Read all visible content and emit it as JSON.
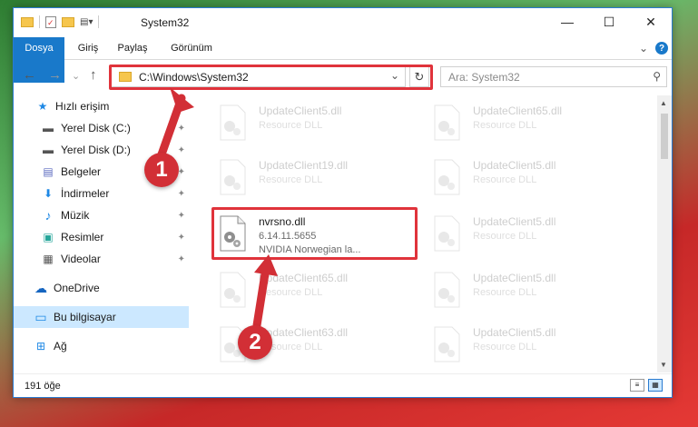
{
  "window": {
    "title": "System32",
    "minimize_glyph": "—",
    "maximize_glyph": "☐",
    "close_glyph": "✕"
  },
  "ribbon": {
    "tabs": [
      "Dosya",
      "Giriş",
      "Paylaş",
      "Görünüm"
    ],
    "expand_glyph": "⌄",
    "help_glyph": "?"
  },
  "nav": {
    "back": "←",
    "forward": "→",
    "recent": "⌄",
    "up": "↑",
    "address": "C:\\Windows\\System32",
    "address_dropdown": "⌄",
    "refresh": "↻",
    "search_placeholder": "Ara: System32",
    "search_glyph": "⚲"
  },
  "sidebar": {
    "items": [
      {
        "label": "Hızlı erişim",
        "icon": "star-icon",
        "glyph": "★",
        "color": "#1e88e5",
        "pinned": false
      },
      {
        "label": "Yerel Disk (C:)",
        "icon": "drive-icon",
        "glyph": "▬",
        "color": "#555555",
        "pinned": true
      },
      {
        "label": "Yerel Disk (D:)",
        "icon": "drive-icon",
        "glyph": "▬",
        "color": "#555555",
        "pinned": true
      },
      {
        "label": "Belgeler",
        "icon": "document-icon",
        "glyph": "▤",
        "color": "#5c6bc0",
        "pinned": true
      },
      {
        "label": "İndirmeler",
        "icon": "download-icon",
        "glyph": "⬇",
        "color": "#1e88e5",
        "pinned": true
      },
      {
        "label": "Müzik",
        "icon": "music-icon",
        "glyph": "♪",
        "color": "#1e88e5",
        "pinned": true
      },
      {
        "label": "Resimler",
        "icon": "pictures-icon",
        "glyph": "▣",
        "color": "#26a69a",
        "pinned": true
      },
      {
        "label": "Videolar",
        "icon": "video-icon",
        "glyph": "▦",
        "color": "#555555",
        "pinned": true
      },
      {
        "label": "OneDrive",
        "icon": "cloud-icon",
        "glyph": "☁",
        "color": "#1565c0",
        "pinned": false
      },
      {
        "label": "Bu bilgisayar",
        "icon": "computer-icon",
        "glyph": "▭",
        "color": "#1e88e5",
        "pinned": false,
        "selected": true
      },
      {
        "label": "Ağ",
        "icon": "network-icon",
        "glyph": "⊞",
        "color": "#1e88e5",
        "pinned": false
      }
    ],
    "pin_glyph": "📌"
  },
  "files": {
    "highlighted": {
      "name": "nvrsno.dll",
      "version": "6.14.11.5655",
      "description": "NVIDIA Norwegian la..."
    },
    "background": [
      {
        "name": "UpdateClient5.dll",
        "type": "Resource DLL"
      },
      {
        "name": "UpdateClient65.dll",
        "type": "Resource DLL"
      },
      {
        "name": "UpdateClient19.dll",
        "type": "Resource DLL"
      },
      {
        "name": "UpdateClient5.dll",
        "type": "Resource DLL"
      },
      {
        "name": "UpdateClient5.dll",
        "type": "Resource DLL"
      },
      {
        "name": "UpdateClient65.dll",
        "type": "Resource DLL"
      },
      {
        "name": "UpdateClient5.dll",
        "type": "Resource DLL"
      },
      {
        "name": "UpdateClient63.dll",
        "type": "Resource DLL"
      },
      {
        "name": "UpdateClient5.dll",
        "type": "Resource DLL"
      }
    ]
  },
  "status": {
    "count": "191 öğe"
  },
  "annotations": {
    "step1": "1",
    "step2": "2"
  },
  "colors": {
    "accent": "#1979ca",
    "highlight": "#e0333b",
    "selected": "#cce8ff"
  }
}
